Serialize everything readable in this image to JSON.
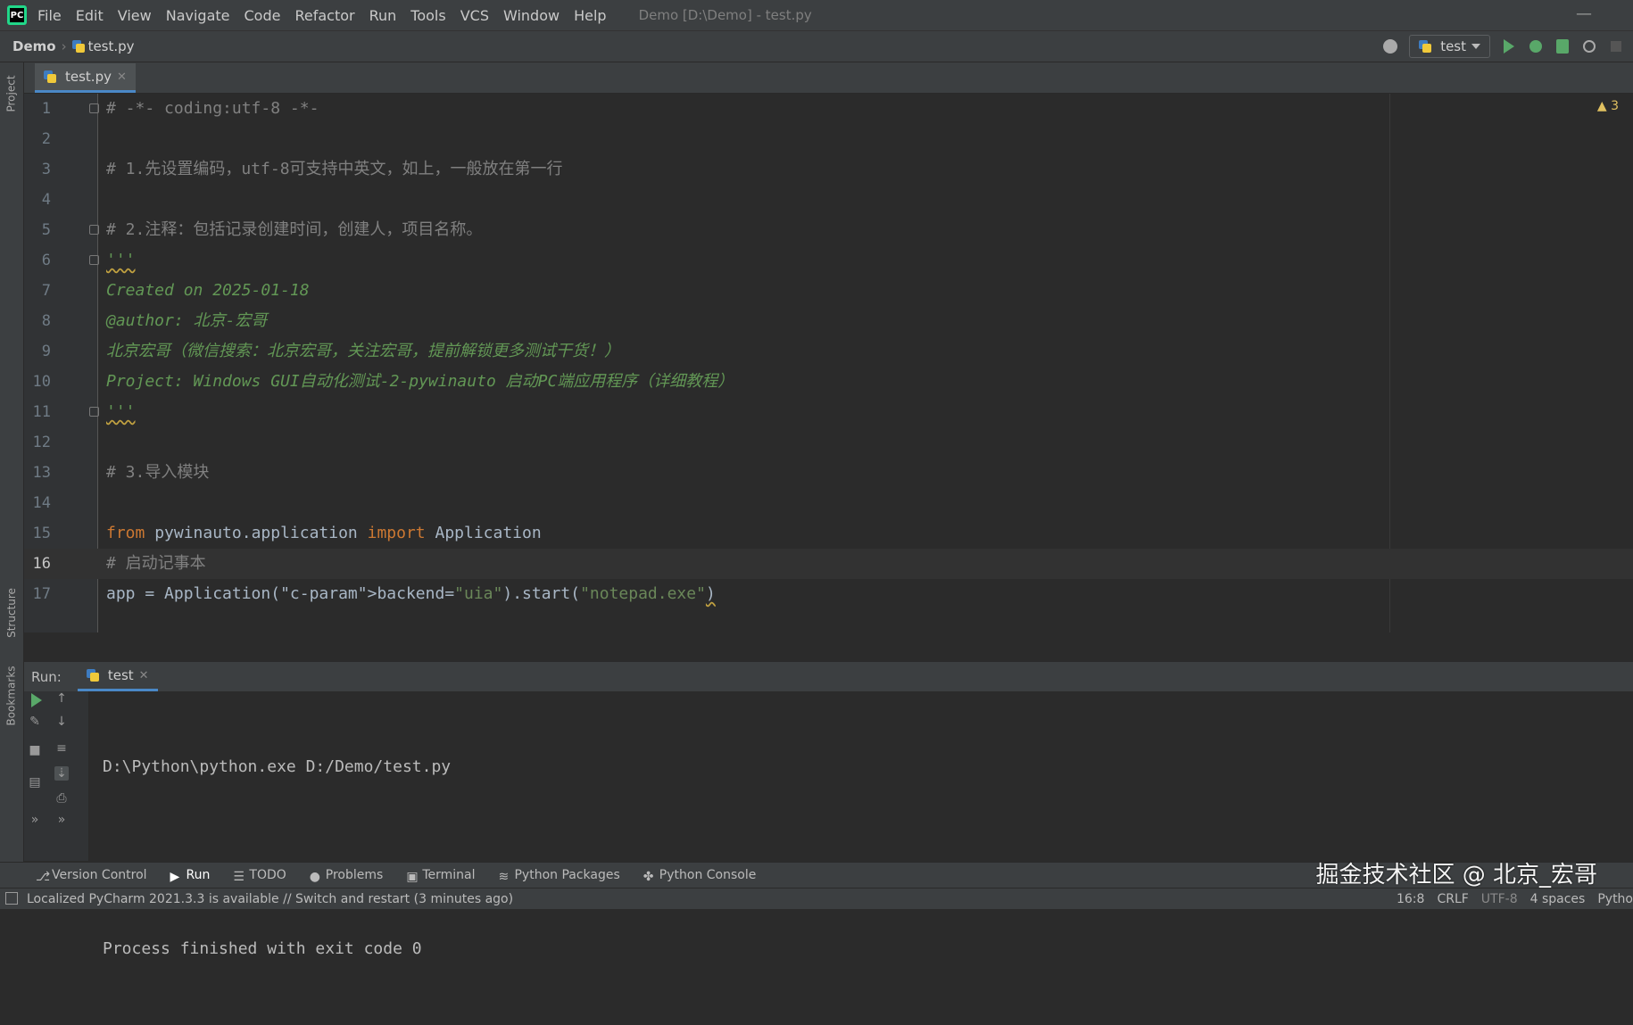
{
  "menubar": {
    "items": [
      "File",
      "Edit",
      "View",
      "Navigate",
      "Code",
      "Refactor",
      "Run",
      "Tools",
      "VCS",
      "Window",
      "Help"
    ],
    "title": "Demo [D:\\Demo] - test.py"
  },
  "navbar": {
    "project": "Demo",
    "file": "test.py",
    "run_config": "test"
  },
  "sidebar": {
    "project_label": "Project",
    "structure_label": "Structure",
    "bookmarks_label": "Bookmarks"
  },
  "editor": {
    "tab": "test.py",
    "lines": [
      {
        "n": "1",
        "t": "# -*- coding:utf-8 -*-"
      },
      {
        "n": "2",
        "t": ""
      },
      {
        "n": "3",
        "t": "# 1.先设置编码，utf-8可支持中英文，如上，一般放在第一行"
      },
      {
        "n": "4",
        "t": ""
      },
      {
        "n": "5",
        "t": "# 2.注释：包括记录创建时间，创建人，项目名称。"
      },
      {
        "n": "6",
        "t": "'''"
      },
      {
        "n": "7",
        "t": "Created on 2025-01-18"
      },
      {
        "n": "8",
        "t": "@author: 北京-宏哥"
      },
      {
        "n": "9",
        "t": "北京宏哥（微信搜索：北京宏哥，关注宏哥，提前解锁更多测试干货！）"
      },
      {
        "n": "10",
        "t": "Project: Windows GUI自动化测试-2-pywinauto 启动PC端应用程序（详细教程）"
      },
      {
        "n": "11",
        "t": "'''"
      },
      {
        "n": "12",
        "t": ""
      },
      {
        "n": "13",
        "t": "# 3.导入模块"
      },
      {
        "n": "14",
        "t": ""
      },
      {
        "n": "15",
        "t": "from pywinauto.application import Application"
      },
      {
        "n": "16",
        "t": "# 启动记事本"
      },
      {
        "n": "17",
        "t": "app = Application(backend=\"uia\").start(\"notepad.exe\")"
      }
    ],
    "warning_count": "3"
  },
  "run": {
    "label": "Run:",
    "tab": "test",
    "output": [
      "D:\\Python\\python.exe D:/Demo/test.py",
      "",
      "Process finished with exit code 0"
    ]
  },
  "toolwindows": [
    {
      "label": "Version Control"
    },
    {
      "label": "Run"
    },
    {
      "label": "TODO"
    },
    {
      "label": "Problems"
    },
    {
      "label": "Terminal"
    },
    {
      "label": "Python Packages"
    },
    {
      "label": "Python Console"
    }
  ],
  "status": {
    "message": "Localized PyCharm 2021.3.3 is available // Switch and restart (3 minutes ago)",
    "position": "16:8",
    "line_sep": "CRLF",
    "encoding": "UTF-8",
    "indent": "4 spaces",
    "interpreter": "Pytho"
  },
  "watermark": "掘金技术社区 @ 北京_宏哥",
  "colors": {
    "accent": "#4a88c7",
    "run_green": "#59a869",
    "doc_green": "#629755"
  }
}
